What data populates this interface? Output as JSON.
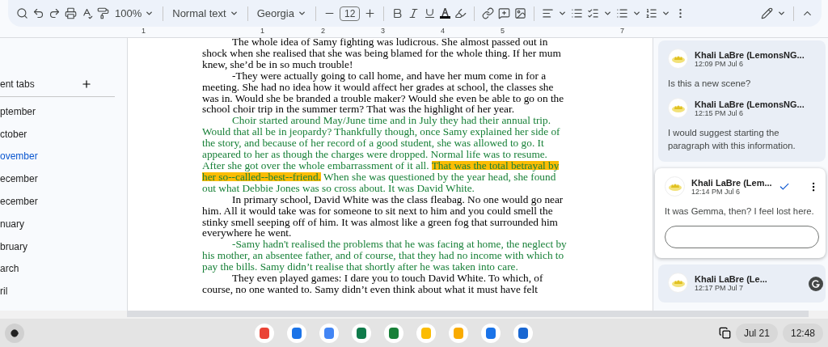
{
  "toolbar": {
    "zoom": "100%",
    "style": "Normal text",
    "font": "Georgia",
    "font_size": "12"
  },
  "ruler": {
    "labels": [
      "1",
      "1",
      "2",
      "3",
      "4",
      "5",
      "7"
    ]
  },
  "sidebar": {
    "title": "ent tabs",
    "items": [
      {
        "label": "ptember",
        "selected": false
      },
      {
        "label": "ctober",
        "selected": false
      },
      {
        "label": "ovember",
        "selected": true
      },
      {
        "label": "ecember",
        "selected": false
      },
      {
        "label": "ecember",
        "selected": false
      },
      {
        "label": "nuary",
        "selected": false
      },
      {
        "label": "bruary",
        "selected": false
      },
      {
        "label": "arch",
        "selected": false
      },
      {
        "label": "ril",
        "selected": false
      }
    ]
  },
  "document": {
    "paragraphs": [
      {
        "kind": "plain",
        "segments": [
          {
            "text": "The whole idea of Samy fighting was ludicrous. She almost passed out in shock when she realised that she was being blamed for the whole thing. If her mum knew, she’d be in so much trouble!",
            "highlighted": false
          }
        ]
      },
      {
        "kind": "plain",
        "segments": [
          {
            "text": "-They were actually going to call home, and have her mum come in for a meeting. She had no idea how it would affect her grades at school, the classes she was in. Would she be branded a trouble maker? Would she even be able to go on the school choir trip in the summer term? That was the highlight of her year.",
            "highlighted": false
          }
        ]
      },
      {
        "kind": "suggested",
        "segments": [
          {
            "text": "Choir started around May/June time and in July they had their annual trip. Would that all be in jeopardy? Thankfully though, once Samy explained her side of the story, and because of her record of a good student, she was allowed to go. It appeared to her as though the charges were dropped. Normal life was to resume. After she got over the whole embarrassment of it all. ",
            "highlighted": false
          },
          {
            "text": "That was the total betrayal by her so--called--best--friend.",
            "highlighted": true
          },
          {
            "text": " When she was questioned by the year head, she found out what Debbie Jones was so cross about. It was David White.",
            "highlighted": false
          }
        ]
      },
      {
        "kind": "plain",
        "segments": [
          {
            "text": "In primary school, David White was the class fleabag. No one would go near him. All it would take was for someone to sit next to him and you could smell the stinky smell seeping off of him. It was almost like a green fog that surrounded him everywhere he went.",
            "highlighted": false
          }
        ]
      },
      {
        "kind": "suggested",
        "segments": [
          {
            "text": "-Samy hadn't realised the problems that he was facing at home, the neglect by his mother, an absentee father, and of course, that they had no income with which to pay the bills. Samy didn’t realise that shortly after he was taken into care.",
            "highlighted": false
          }
        ]
      },
      {
        "kind": "plain",
        "segments": [
          {
            "text": "They even played games: I dare you to touch David White. To which, of course, no one wanted to. Samy didn’t even think about what it must have felt",
            "highlighted": false
          }
        ]
      }
    ]
  },
  "comments": {
    "threads": [
      {
        "active": false,
        "comments": [
          {
            "author": "Khali LaBre (LemonsNG...",
            "time": "12:09 PM Jul 6",
            "text": "Is this a new scene?"
          },
          {
            "author": "Khali LaBre (LemonsNG...",
            "time": "12:15 PM Jul 6",
            "text": "I would suggest starting the paragraph with this information."
          }
        ]
      },
      {
        "active": true,
        "comments": [
          {
            "author": "Khali LaBre (Lem...",
            "time": "12:14 PM Jul 6",
            "text": "It was Gemma, then? I feel lost here."
          }
        ]
      },
      {
        "active": false,
        "comments": [
          {
            "author": "Khali LaBre (Le...",
            "time": "12:17 PM Jul 7"
          }
        ]
      }
    ]
  },
  "taskbar": {
    "apps": [
      {
        "color": "#ea4335"
      },
      {
        "color": "#1a73e8"
      },
      {
        "color": "#4285f4"
      },
      {
        "color": "#0f7b4b"
      },
      {
        "color": "#188038"
      },
      {
        "color": "#fbbc04"
      },
      {
        "color": "#f9ab00"
      },
      {
        "color": "#1a73e8"
      },
      {
        "color": "#1967d2"
      }
    ],
    "date": "Jul 21",
    "time": "12:48"
  }
}
